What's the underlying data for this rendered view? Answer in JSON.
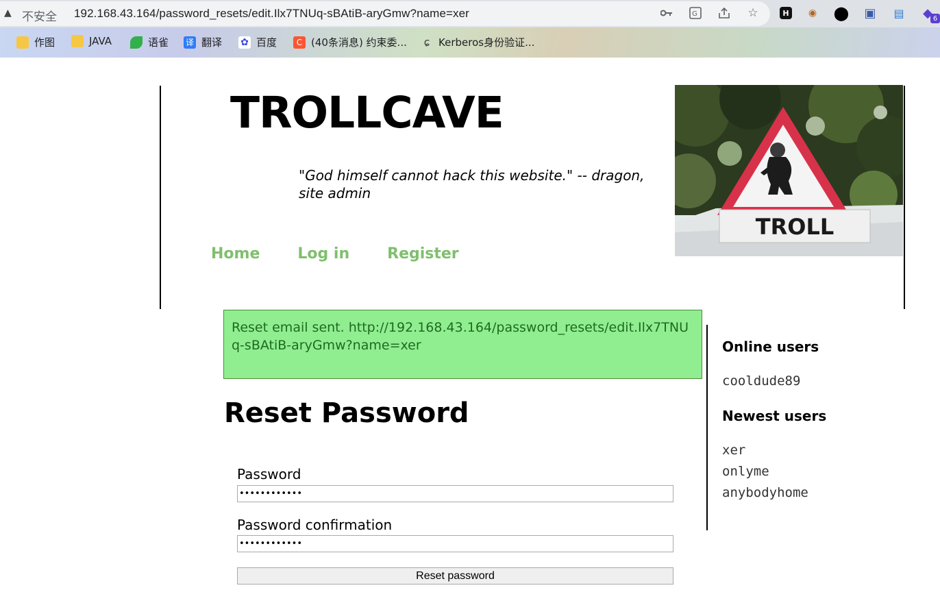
{
  "browser": {
    "security_label": "不安全",
    "url": "192.168.43.164/password_resets/edit.Ilx7TNUq-sBAtiB-aryGmw?name=xer",
    "extension_badge": "6"
  },
  "bookmarks": [
    {
      "label": "作图",
      "icon": "folder-icon",
      "color": "#f6c744"
    },
    {
      "label": "JAVA",
      "icon": "folder-icon",
      "color": "#f6c744"
    },
    {
      "label": "语雀",
      "icon": "yuque-icon",
      "color": "#31b04b"
    },
    {
      "label": "翻译",
      "icon": "translate-icon",
      "color": "#2f7cf6"
    },
    {
      "label": "百度",
      "icon": "baidu-icon",
      "color": "#3245df"
    },
    {
      "label": "(40条消息) 约束委...",
      "icon": "csdn-icon",
      "color": "#fc5531"
    },
    {
      "label": "Kerberos身份验证...",
      "icon": "kerberos-icon",
      "color": "#444444"
    }
  ],
  "site": {
    "title": "TROLLCAVE",
    "tagline": "\"God himself cannot hack this website.\" -- dragon, site admin",
    "nav": [
      "Home",
      "Log in",
      "Register"
    ],
    "image_sign_text": "TROLL",
    "accent_color": "#7fbf6e"
  },
  "notice": {
    "text": "Reset email sent. http://192.168.43.164/password_resets/edit.Ilx7TNUq-sBAtiB-aryGmw?name=xer"
  },
  "form": {
    "heading": "Reset Password",
    "password_label": "Password",
    "password_value": "••••••••••••",
    "confirmation_label": "Password confirmation",
    "confirmation_value": "••••••••••••",
    "submit_label": "Reset password"
  },
  "sidebar": {
    "online_heading": "Online users",
    "online_users": [
      "cooldude89"
    ],
    "newest_heading": "Newest users",
    "newest_users": [
      "xer",
      "onlyme",
      "anybodyhome"
    ]
  }
}
